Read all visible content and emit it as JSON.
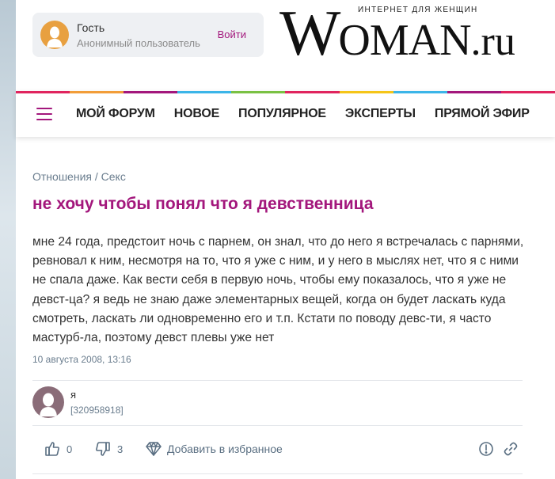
{
  "colors": {
    "accent": "#a3177c",
    "breadcrumb": "#6a7d8e",
    "avatar_orange": "#e8a040"
  },
  "header": {
    "user": {
      "name": "Гость",
      "subtitle": "Анонимный пользователь",
      "login_label": "Войти",
      "avatar_icon": "user-silhouette-icon"
    },
    "logo": {
      "tagline": "ИНТЕРНЕТ ДЛЯ ЖЕНЩИН",
      "initial": "W",
      "rest": "OMAN",
      "domain": ".ru"
    }
  },
  "nav": {
    "menu_icon": "hamburger-icon",
    "items": [
      "МОЙ ФОРУМ",
      "НОВОЕ",
      "ПОПУЛЯРНОЕ",
      "ЭКСПЕРТЫ",
      "ПРЯМОЙ ЭФИР"
    ],
    "stripe_colors": [
      "#e0245e",
      "#f29d38",
      "#a3177c",
      "#3bb5e8",
      "#7ac143",
      "#e0245e",
      "#f5c518",
      "#3bb5e8",
      "#a3177c",
      "#e0245e"
    ]
  },
  "article": {
    "breadcrumb": {
      "first": "Отношения",
      "sep": "/",
      "second": "Секс"
    },
    "title": "не хочу чтобы понял что я девственница",
    "body": "мне 24 года, предстоит ночь с парнем, он знал, что до него я встречалась с парнями, ревновал к ним, несмотря на то, что я уже с ним, и у него в мыслях нет, что я с ними не спала даже. Как вести себя в первую ночь, чтобы ему показалось, что я уже не девст-ца? я ведь не знаю даже элементарных вещей, когда он будет ласкать куда смотреть, ласкать ли одновременно его и т.п. Кстати по поводу девс-ти, я часто мастурб-ла, поэтому девст плевы уже нет",
    "date": "10 августа 2008, 13:16"
  },
  "author": {
    "name": "я",
    "id": "[320958918]",
    "avatar_icon": "user-silhouette-icon"
  },
  "actions": {
    "likes": "0",
    "dislikes": "3",
    "favorite_label": "Добавить в избранное",
    "like_icon": "thumbs-up-icon",
    "dislike_icon": "thumbs-down-icon",
    "favorite_icon": "diamond-icon",
    "report_icon": "exclamation-circle-icon",
    "share_icon": "link-icon"
  }
}
